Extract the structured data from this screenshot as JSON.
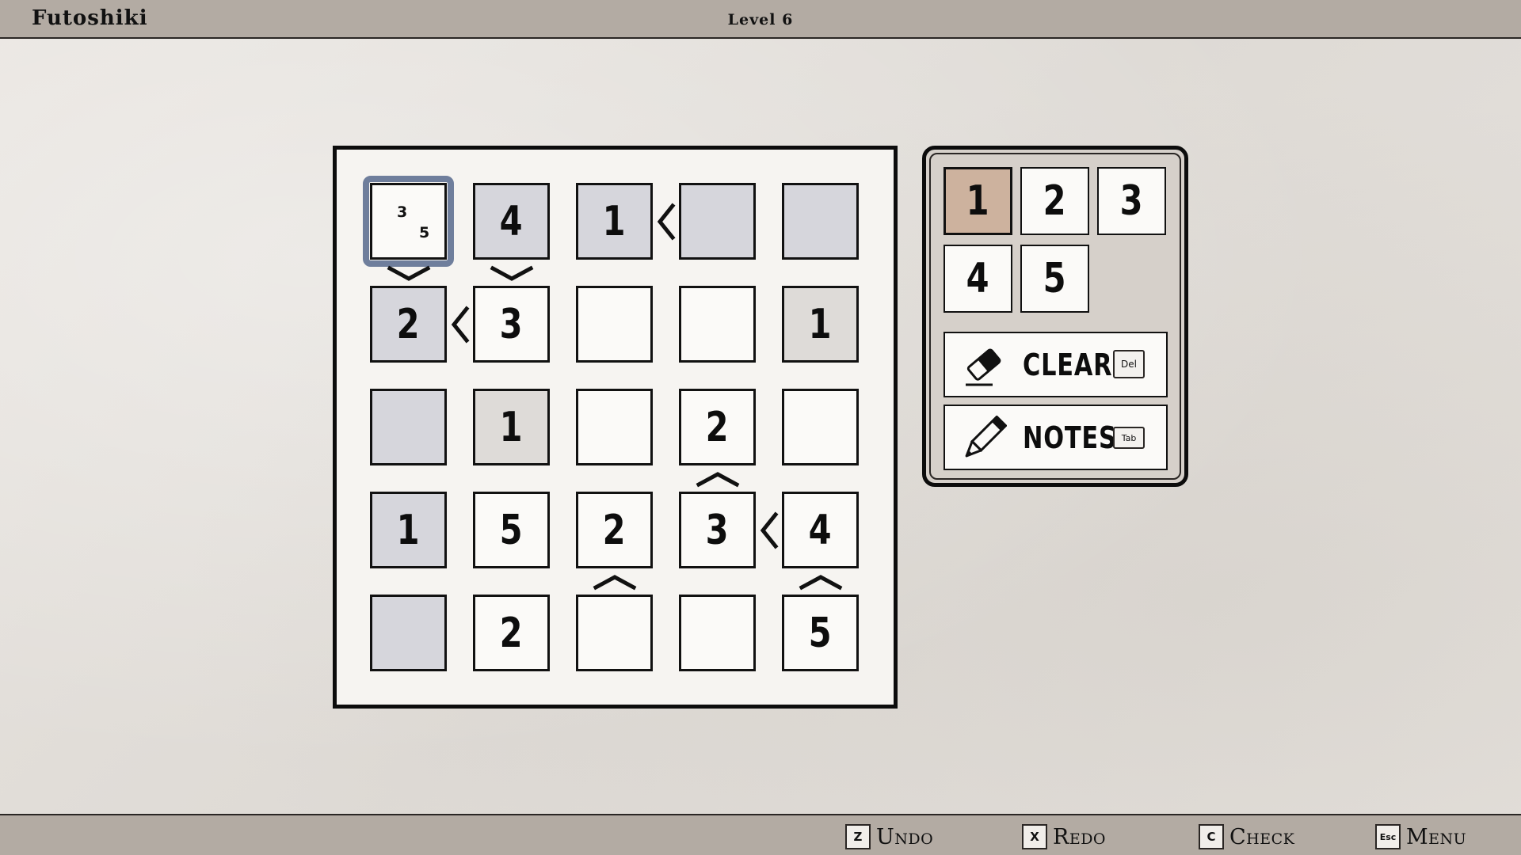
{
  "header": {
    "app_title": "Futoshiki",
    "level": "Level 6"
  },
  "board": {
    "selected": "0-0",
    "cells": [
      [
        "",
        "4",
        "1",
        "",
        ""
      ],
      [
        "2",
        "3",
        "",
        "",
        "1"
      ],
      [
        "",
        "1",
        "",
        "2",
        ""
      ],
      [
        "1",
        "5",
        "2",
        "3",
        "4"
      ],
      [
        "",
        "2",
        "",
        "",
        "5"
      ]
    ],
    "given_cool": [
      "0-1",
      "0-2",
      "0-3",
      "0-4",
      "1-0",
      "2-0",
      "3-0",
      "4-0"
    ],
    "given_warm": [
      "1-4",
      "2-1"
    ],
    "notes": {
      "0-0": [
        "3",
        "5"
      ]
    },
    "constraints": [
      {
        "from": "0-2",
        "to": "0-3",
        "sign": "<"
      },
      {
        "from": "0-0",
        "to": "1-0",
        "sign": "v"
      },
      {
        "from": "0-1",
        "to": "1-1",
        "sign": "v"
      },
      {
        "from": "1-0",
        "to": "1-1",
        "sign": "<"
      },
      {
        "from": "2-3",
        "to": "3-3",
        "sign": "^"
      },
      {
        "from": "3-3",
        "to": "3-4",
        "sign": "<"
      },
      {
        "from": "3-2",
        "to": "4-2",
        "sign": "^"
      },
      {
        "from": "3-4",
        "to": "4-4",
        "sign": "^"
      }
    ]
  },
  "panel": {
    "numbers": [
      "1",
      "2",
      "3",
      "4",
      "5"
    ],
    "active_number": "1",
    "clear": {
      "label": "CLEAR",
      "key": "Del",
      "icon": "eraser-icon"
    },
    "notes": {
      "label": "NOTES",
      "key": "Tab",
      "icon": "pencil-icon"
    }
  },
  "footer": {
    "actions": [
      {
        "key": "Z",
        "label": "Undo"
      },
      {
        "key": "X",
        "label": "Redo"
      },
      {
        "key": "C",
        "label": "Check"
      },
      {
        "key": "Esc",
        "label": "Menu"
      }
    ]
  }
}
